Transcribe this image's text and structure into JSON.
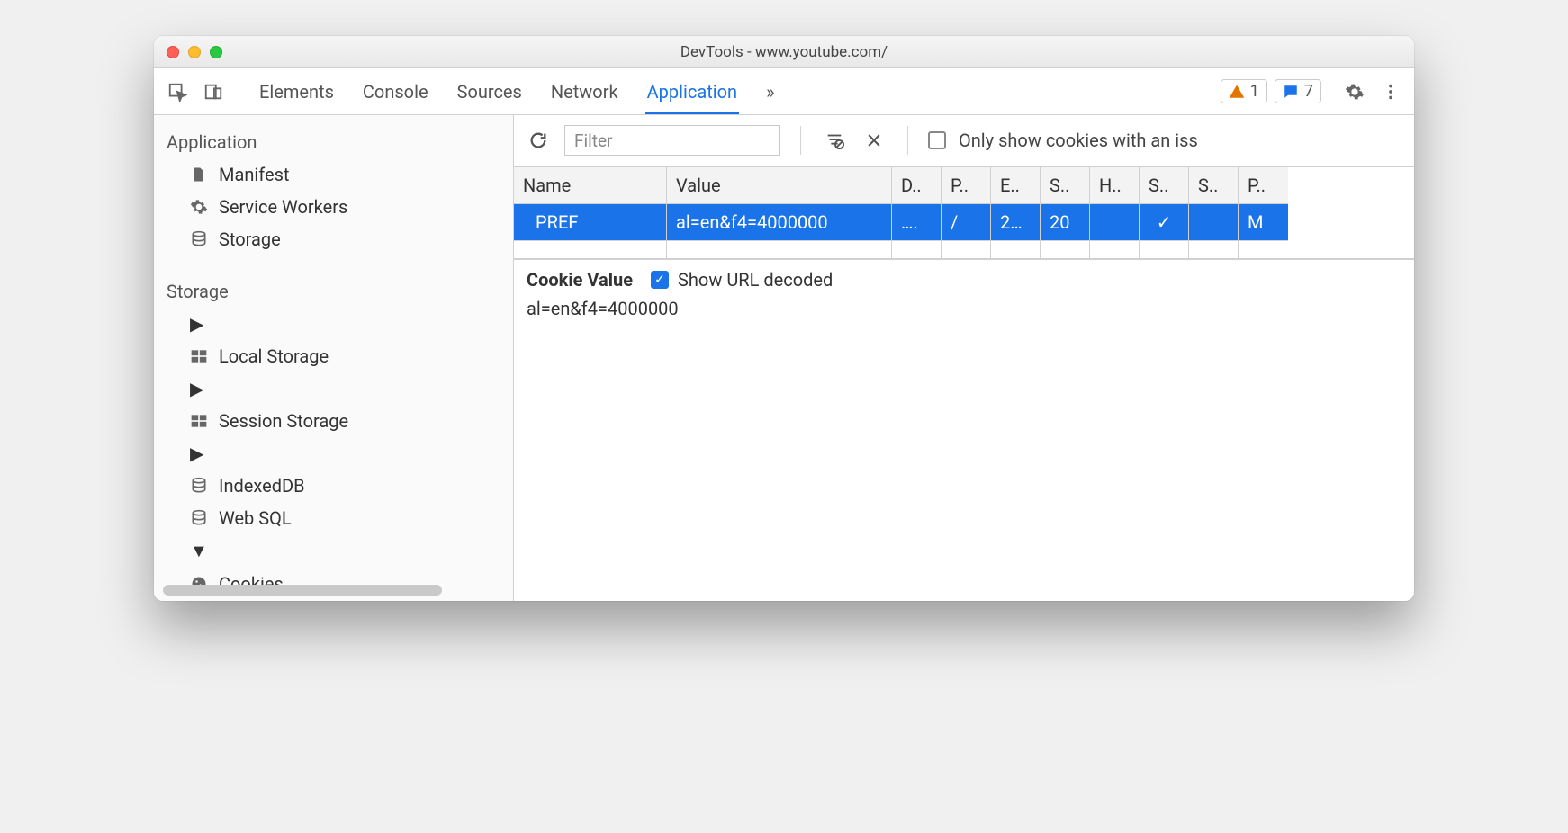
{
  "window": {
    "title": "DevTools - www.youtube.com/"
  },
  "tabs": {
    "items": [
      "Elements",
      "Console",
      "Sources",
      "Network",
      "Application"
    ],
    "overflow": "»",
    "active": "Application"
  },
  "badges": {
    "warning_count": "1",
    "message_count": "7"
  },
  "sidebar": {
    "section1": "Application",
    "app_items": [
      {
        "label": "Manifest"
      },
      {
        "label": "Service Workers"
      },
      {
        "label": "Storage"
      }
    ],
    "section2": "Storage",
    "storage_items": [
      {
        "label": "Local Storage",
        "expandable": true
      },
      {
        "label": "Session Storage",
        "expandable": true
      },
      {
        "label": "IndexedDB",
        "expandable": true
      },
      {
        "label": "Web SQL",
        "expandable": false
      },
      {
        "label": "Cookies",
        "expandable": true,
        "expanded": true
      }
    ]
  },
  "toolbar": {
    "filter_placeholder": "Filter",
    "only_issue_label": "Only show cookies with an iss"
  },
  "table": {
    "headers": [
      "Name",
      "Value",
      "D..",
      "P..",
      "E..",
      "S..",
      "H..",
      "S..",
      "S..",
      "P.."
    ],
    "row": {
      "name": "PREF",
      "value": "al=en&f4=4000000",
      "domain": "….",
      "path": "/",
      "expires": "2…",
      "size": "20",
      "http": "",
      "secure": "✓",
      "same": "",
      "priority": "M"
    }
  },
  "detail": {
    "heading": "Cookie Value",
    "decode_label": "Show URL decoded",
    "value": "al=en&f4=4000000"
  }
}
